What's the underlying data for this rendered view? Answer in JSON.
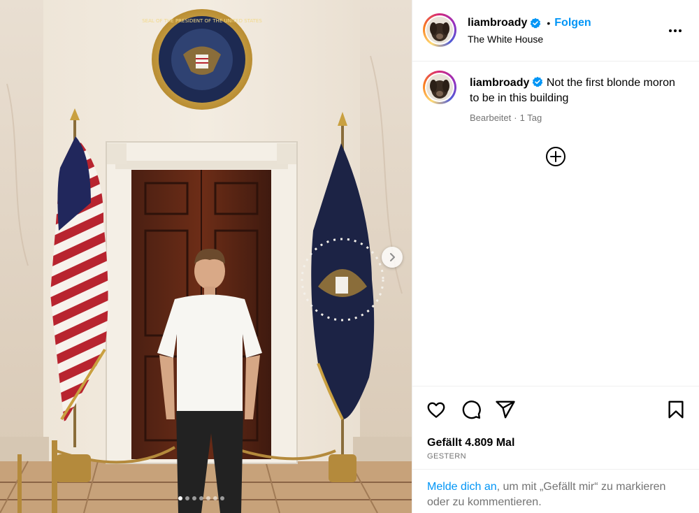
{
  "post": {
    "username": "liambroady",
    "follow_label": "Folgen",
    "separator": "•",
    "location": "The White House",
    "caption": "Not the first blonde moron to be in this building",
    "edited_label": "Bearbeitet",
    "edited_sep": "·",
    "edited_time": "1 Tag",
    "likes_text": "Gefällt 4.809 Mal",
    "date_label": "GESTERN"
  },
  "carousel": {
    "slide_count": 7,
    "active_index": 0
  },
  "login_prompt": {
    "link_text": "Melde dich an",
    "rest_text": ", um mit „Gefällt mir“ zu markieren oder zu kommentieren."
  },
  "photo_text": {
    "seal_top": "SEAL OF THE PRESIDENT OF THE UNITED STATES"
  },
  "icons": {
    "more": "more-options-icon",
    "verified": "verified-badge-icon",
    "add_comment": "plus-circle-icon",
    "like": "heart-icon",
    "comment": "comment-icon",
    "share": "share-icon",
    "save": "bookmark-icon",
    "next": "chevron-right-icon"
  },
  "colors": {
    "link_blue": "#0095f6",
    "muted": "#737373",
    "divider": "#efefef"
  }
}
